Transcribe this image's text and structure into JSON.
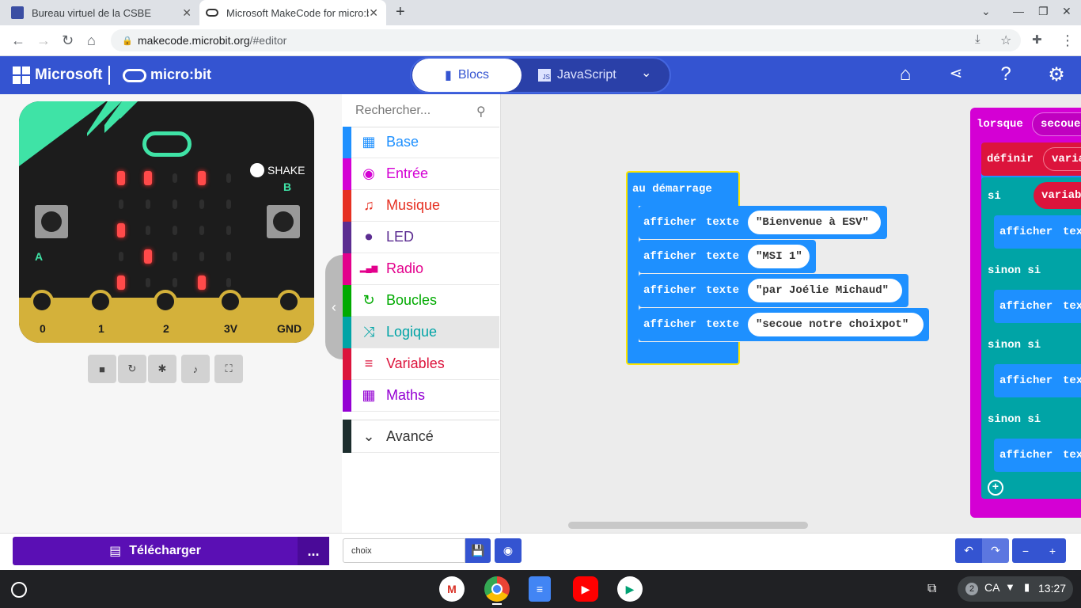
{
  "browser": {
    "tabs": [
      {
        "title": "Bureau virtuel de la CSBE",
        "favicon": "csbe-favicon"
      },
      {
        "title": "Microsoft MakeCode for micro:bi",
        "favicon": "microbit-favicon",
        "active": true
      }
    ],
    "url_host": "makecode.microbit.org",
    "url_path": "/#editor"
  },
  "header": {
    "brand": "Microsoft",
    "product": "micro:bit",
    "modes": {
      "blocks": "Blocs",
      "javascript": "JavaScript"
    },
    "icons": [
      "home-icon",
      "share-icon",
      "help-icon",
      "settings-icon"
    ],
    "color": "#3454d1"
  },
  "simulator": {
    "shake_label": "SHAKE",
    "button_a": "A",
    "button_b": "B",
    "pins": [
      "0",
      "1",
      "2",
      "3V",
      "GND"
    ],
    "leds": [
      [
        1,
        1,
        0,
        1,
        0
      ],
      [
        0,
        0,
        0,
        0,
        0
      ],
      [
        1,
        0,
        0,
        0,
        0
      ],
      [
        0,
        1,
        0,
        0,
        0
      ],
      [
        1,
        0,
        0,
        1,
        0
      ]
    ],
    "controls": [
      "stop-icon",
      "restart-icon",
      "debug-icon",
      "sound-icon",
      "fullscreen-icon"
    ]
  },
  "toolbox": {
    "search_placeholder": "Rechercher...",
    "categories": [
      {
        "label": "Base",
        "color": "#1e90ff",
        "icon": "grid-icon"
      },
      {
        "label": "Entrée",
        "color": "#d400d4",
        "icon": "target-icon"
      },
      {
        "label": "Musique",
        "color": "#e63022",
        "icon": "headphones-icon"
      },
      {
        "label": "LED",
        "color": "#5c2d91",
        "icon": "toggle-icon"
      },
      {
        "label": "Radio",
        "color": "#e3008c",
        "icon": "signal-icon"
      },
      {
        "label": "Boucles",
        "color": "#00aa00",
        "icon": "loop-icon"
      },
      {
        "label": "Logique",
        "color": "#00a4a6",
        "icon": "shuffle-icon",
        "selected": true
      },
      {
        "label": "Variables",
        "color": "#dc143c",
        "icon": "lines-icon"
      },
      {
        "label": "Maths",
        "color": "#9400d3",
        "icon": "calculator-icon"
      }
    ],
    "advanced": "Avancé"
  },
  "workspace": {
    "start_block": {
      "label": "au démarrage",
      "statements": [
        {
          "kw1": "afficher",
          "kw2": "texte",
          "value": "Bienvenue à ESV "
        },
        {
          "kw1": "afficher",
          "kw2": "texte",
          "value": "MSI 1 "
        },
        {
          "kw1": "afficher",
          "kw2": "texte",
          "value": "par Joélie Michaud  "
        },
        {
          "kw1": "afficher",
          "kw2": "texte",
          "value": "secoue notre choixpot  "
        }
      ]
    },
    "shake_block": {
      "label": "lorsque",
      "event": "secouer",
      "set": "définir",
      "var": "varia",
      "if": "si",
      "if_var": "variab",
      "show": "afficher",
      "show_text": "tex",
      "elseif": "sinon si"
    }
  },
  "bottom": {
    "download": "Télécharger",
    "more": "...",
    "project_name": "choix"
  },
  "shelf": {
    "apps": [
      "gmail-icon",
      "chrome-icon",
      "docs-icon",
      "youtube-icon",
      "play-store-icon"
    ],
    "notifications": "2",
    "keyboard": "CA",
    "time": "13:27"
  }
}
